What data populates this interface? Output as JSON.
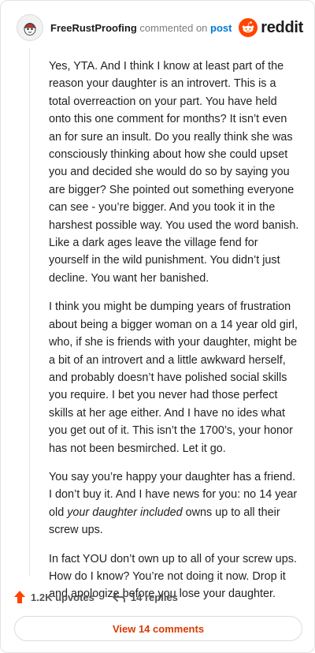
{
  "comment": {
    "username": "FreeRustProofing",
    "action_text": "commented on",
    "post_link_label": "post",
    "paragraphs": [
      "Yes, YTA. And I think I know at least part of the reason your daughter is an introvert. This is a total overreaction on your part. You have held onto this one comment for months? It isn’t even an for sure an insult. Do you really think she was consciously thinking about how she could upset you and decided she would do so by saying you are bigger? She pointed out something everyone can see - you’re bigger. And you took it in the harshest possible way. You used the word banish. Like a dark ages leave the village fend for yourself in the wild punishment. You didn’t just decline. You want her banished.",
      "I think you might be dumping years of frustration about being a bigger woman on a 14 year old girl, who, if she is friends with your daughter, might be a bit of an introvert and a little awkward herself, and probably doesn’t have polished social skills you require. I bet you never had those perfect skills at her age either. And I have no ides what you get out of it. This isn’t the 1700’s, your honor has not been besmirched. Let it go.",
      {
        "before": "You say you’re happy your daughter has a friend. I don’t buy it. And I have news for you: no 14 year old ",
        "italic": "your daughter included",
        "after": " owns up to all their screw ups."
      },
      "In fact YOU don’t own up to all of your screw ups. How do I know? You’re not doing it now. Drop it and apologize before you lose your daughter."
    ]
  },
  "brand": {
    "name": "reddit",
    "icon": "reddit-logo-icon",
    "color": "#ff4500"
  },
  "footer": {
    "upvotes_label": "1.2K upvotes",
    "replies_label": "14 replies",
    "view_comments_label": "View 14 comments"
  },
  "colors": {
    "accent": "#d93a00",
    "link": "#0079d3",
    "upvote": "#ff4500"
  }
}
